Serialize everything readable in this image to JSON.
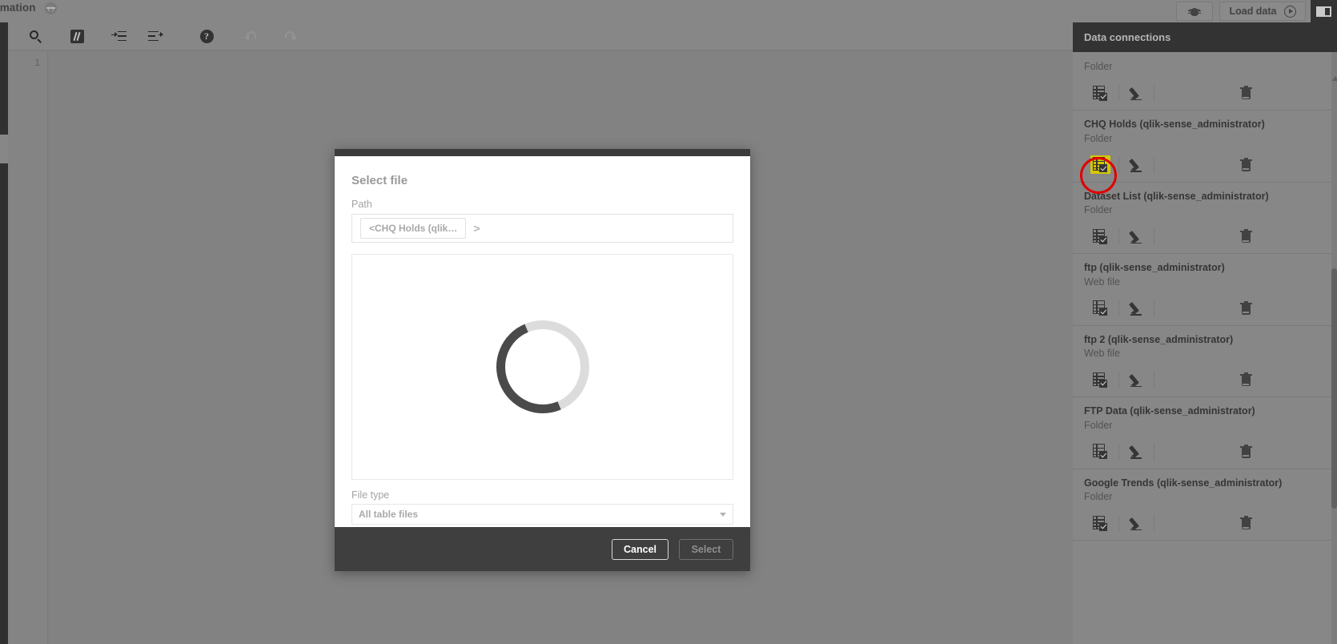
{
  "header": {
    "app_title": "ormation",
    "globe_icon": "globe-icon",
    "debug_button_label": "",
    "debug_icon": "bug-icon",
    "load_data_label": "Load data",
    "load_data_icon": "play-circle-icon",
    "panel_toggle_icon": "panel-toggle-icon"
  },
  "toolbar": {
    "items": [
      {
        "name": "search",
        "icon": "search-icon",
        "disabled": false
      },
      {
        "name": "comment",
        "icon": "comment-icon",
        "disabled": false
      },
      {
        "name": "indent",
        "icon": "indent-icon",
        "disabled": false
      },
      {
        "name": "outdent",
        "icon": "outdent-icon",
        "disabled": false
      },
      {
        "name": "help",
        "icon": "help-icon",
        "disabled": false
      },
      {
        "name": "undo",
        "icon": "undo-icon",
        "disabled": true
      },
      {
        "name": "redo",
        "icon": "redo-icon",
        "disabled": true
      }
    ]
  },
  "editor": {
    "line_numbers": [
      "1"
    ],
    "content": ""
  },
  "right_panel": {
    "title": "Data connections",
    "action_icons": {
      "select_data": "select-data-icon",
      "edit": "pencil-icon",
      "delete": "trash-icon"
    },
    "connections": [
      {
        "name": "",
        "type": "Folder",
        "highlighted": false,
        "partial": true
      },
      {
        "name": "CHQ Holds (qlik-sense_administrator)",
        "type": "Folder",
        "highlighted": true,
        "partial": false
      },
      {
        "name": "Dataset List (qlik-sense_administrator)",
        "type": "Folder",
        "highlighted": false,
        "partial": false
      },
      {
        "name": "ftp (qlik-sense_administrator)",
        "type": "Web file",
        "highlighted": false,
        "partial": false
      },
      {
        "name": "ftp 2 (qlik-sense_administrator)",
        "type": "Web file",
        "highlighted": false,
        "partial": false
      },
      {
        "name": "FTP Data (qlik-sense_administrator)",
        "type": "Folder",
        "highlighted": false,
        "partial": false
      },
      {
        "name": "Google Trends (qlik-sense_administrator)",
        "type": "Folder",
        "highlighted": false,
        "partial": false
      }
    ]
  },
  "modal": {
    "title": "Select file",
    "path_label": "Path",
    "path_crumb": "<CHQ Holds (qlik…",
    "path_separator": ">",
    "loading": true,
    "loading_icon": "spinner-icon",
    "file_type_label": "File type",
    "file_type_value": "All table files",
    "file_type_caret": "chevron-down-icon",
    "cancel_label": "Cancel",
    "select_label": "Select"
  },
  "annotation": {
    "ring_color": "#ff0000",
    "highlight_color": "#f2e200"
  }
}
